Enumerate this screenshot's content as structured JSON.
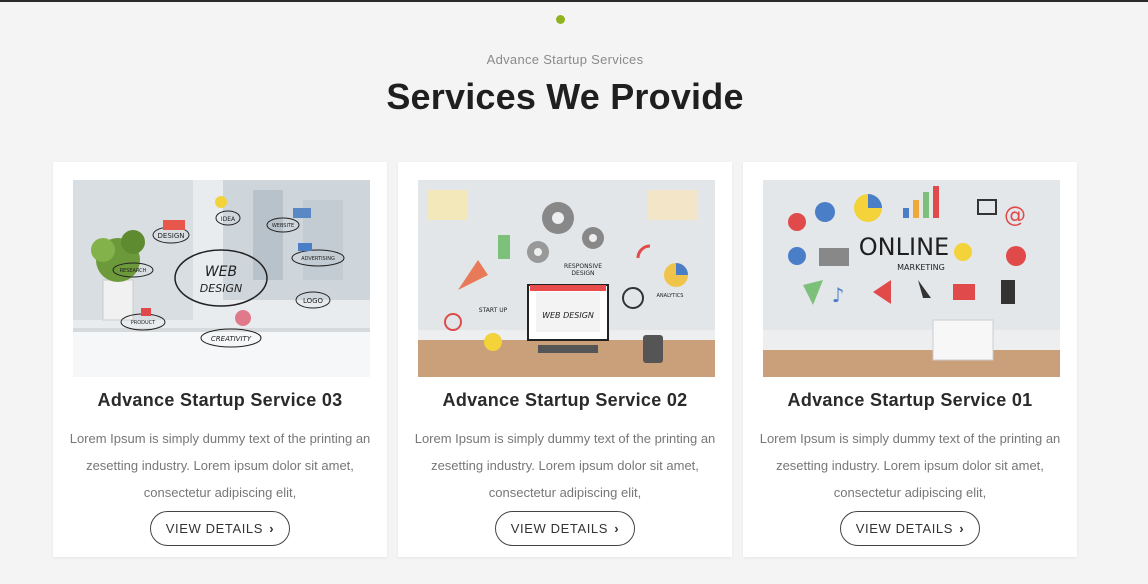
{
  "section": {
    "subtitle": "Advance Startup Services",
    "title": "Services We Provide"
  },
  "colors": {
    "accent_dot": "#8fb320",
    "background": "#f4f4f4",
    "title": "#1f1f1f"
  },
  "cards": [
    {
      "title": "Advance Startup Service 03",
      "text": "Lorem Ipsum is simply dummy text of the printing an zesetting industry. Lorem ipsum dolor sit amet, consectetur adipiscing elit,",
      "button_label": "VIEW DETAILS",
      "button_icon": "chevron-right-icon",
      "image_labels": [
        "WEB",
        "DESIGN",
        "DESIGN",
        "IDEA",
        "WEBSITE",
        "RESEARCH",
        "ADVERTISING",
        "LOGO",
        "PRODUCT",
        "CREATIVITY"
      ]
    },
    {
      "title": "Advance Startup Service 02",
      "text": "Lorem Ipsum is simply dummy text of the printing an zesetting industry. Lorem ipsum dolor sit amet, consectetur adipiscing elit,",
      "button_label": "VIEW DETAILS",
      "button_icon": "chevron-right-icon",
      "image_labels": [
        "RESPONSIVE",
        "DESIGN",
        "WEB DESIGN",
        "START UP",
        "ANALYTICS"
      ]
    },
    {
      "title": "Advance Startup Service 01",
      "text": "Lorem Ipsum is simply dummy text of the printing an zesetting industry. Lorem ipsum dolor sit amet, consectetur adipiscing elit,",
      "button_label": "VIEW DETAILS",
      "button_icon": "chevron-right-icon",
      "image_labels": [
        "ONLINE",
        "MARKETING",
        "@"
      ]
    }
  ]
}
